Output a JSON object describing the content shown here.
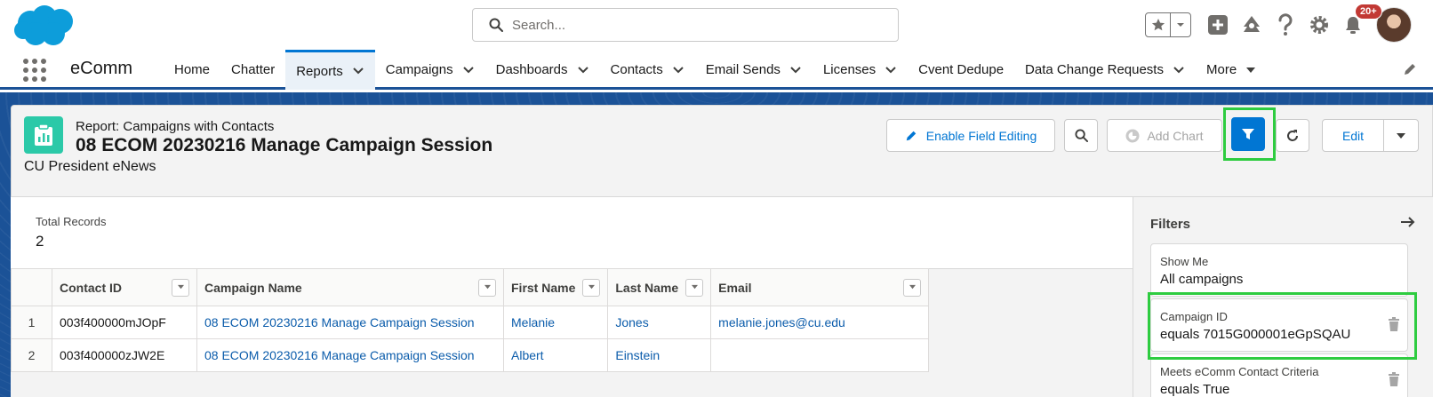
{
  "header": {
    "search_placeholder": "Search...",
    "notification_count": "20+"
  },
  "nav": {
    "app_name": "eComm",
    "items": [
      {
        "label": "Home",
        "has_menu": false,
        "active": false
      },
      {
        "label": "Chatter",
        "has_menu": false,
        "active": false
      },
      {
        "label": "Reports",
        "has_menu": true,
        "active": true
      },
      {
        "label": "Campaigns",
        "has_menu": true,
        "active": false
      },
      {
        "label": "Dashboards",
        "has_menu": true,
        "active": false
      },
      {
        "label": "Contacts",
        "has_menu": true,
        "active": false
      },
      {
        "label": "Email Sends",
        "has_menu": true,
        "active": false
      },
      {
        "label": "Licenses",
        "has_menu": true,
        "active": false
      },
      {
        "label": "Cvent Dedupe",
        "has_menu": false,
        "active": false
      },
      {
        "label": "Data Change Requests",
        "has_menu": true,
        "active": false
      }
    ],
    "more_label": "More"
  },
  "report": {
    "type_label": "Report: Campaigns with Contacts",
    "title": "08 ECOM 20230216 Manage Campaign Session",
    "description": "CU President eNews",
    "buttons": {
      "enable_field_editing": "Enable Field Editing",
      "add_chart": "Add Chart",
      "edit": "Edit"
    },
    "total_records_label": "Total Records",
    "total_records_value": "2",
    "columns": [
      "Contact ID",
      "Campaign Name",
      "First Name",
      "Last Name",
      "Email"
    ],
    "rows": [
      {
        "num": "1",
        "contact_id": "003f400000mJOpF",
        "campaign_name": "08 ECOM 20230216 Manage Campaign Session",
        "first_name": "Melanie",
        "last_name": "Jones",
        "email": "melanie.jones@cu.edu"
      },
      {
        "num": "2",
        "contact_id": "003f400000zJW2E",
        "campaign_name": "08 ECOM 20230216 Manage Campaign Session",
        "first_name": "Albert",
        "last_name": "Einstein",
        "email": ""
      }
    ]
  },
  "filters": {
    "title": "Filters",
    "items": [
      {
        "label": "Show Me",
        "value": "All campaigns",
        "deletable": false
      },
      {
        "label": "Campaign ID",
        "value": "equals 7015G000001eGpSQAU",
        "deletable": true
      },
      {
        "label": "Meets eComm Contact Criteria",
        "value": "equals True",
        "deletable": true
      }
    ]
  },
  "colors": {
    "brand_blue": "#0176d3",
    "nav_bar_blue": "#1b5297",
    "report_icon_teal": "#2bc9a8",
    "highlight_green": "#2ecc40",
    "badge_red": "#c23934"
  }
}
